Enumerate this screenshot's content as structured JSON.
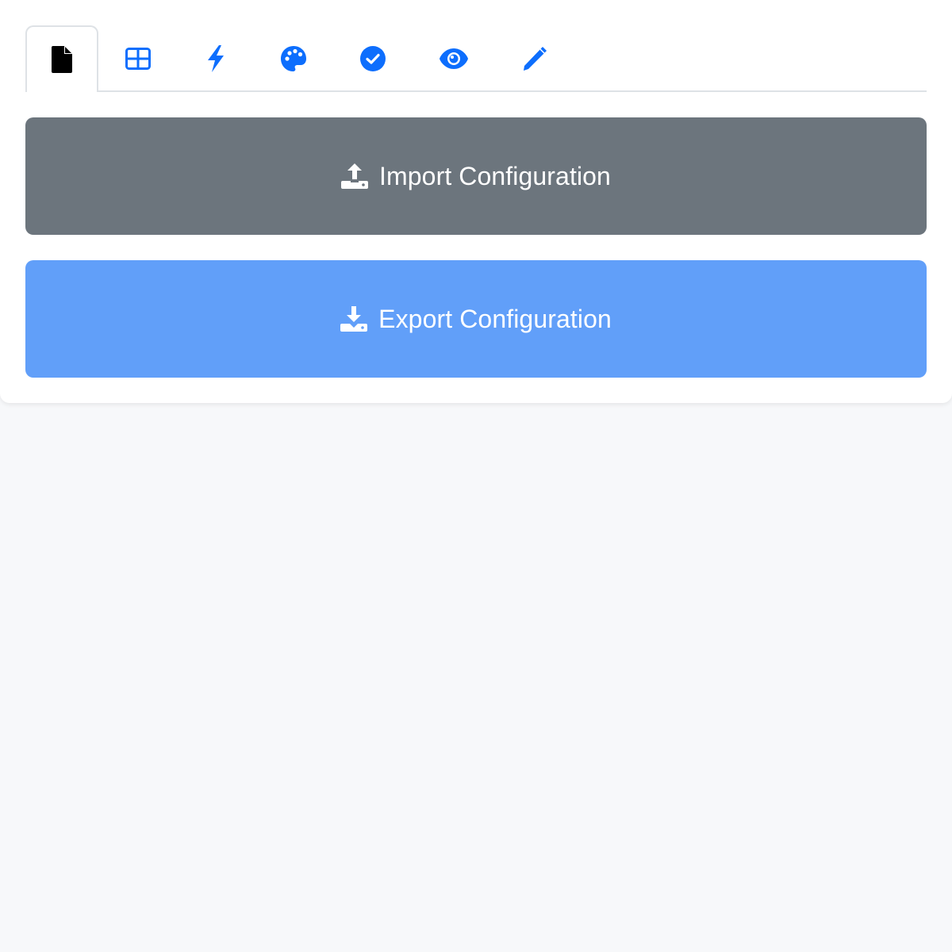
{
  "colors": {
    "accent": "#0d6efd",
    "active_icon": "#000000",
    "import_button": "#6c757d",
    "export_button": "#619ff9",
    "page_background": "#f7f8fa"
  },
  "tabs": [
    {
      "icon": "file-icon",
      "active": true
    },
    {
      "icon": "table-grid-icon",
      "active": false
    },
    {
      "icon": "lightning-icon",
      "active": false
    },
    {
      "icon": "palette-icon",
      "active": false
    },
    {
      "icon": "check-circle-icon",
      "active": false
    },
    {
      "icon": "eye-icon",
      "active": false
    },
    {
      "icon": "pencil-icon",
      "active": false
    }
  ],
  "actions": {
    "import_label": "Import Configuration",
    "import_icon": "upload-icon",
    "export_label": "Export Configuration",
    "export_icon": "download-icon"
  }
}
